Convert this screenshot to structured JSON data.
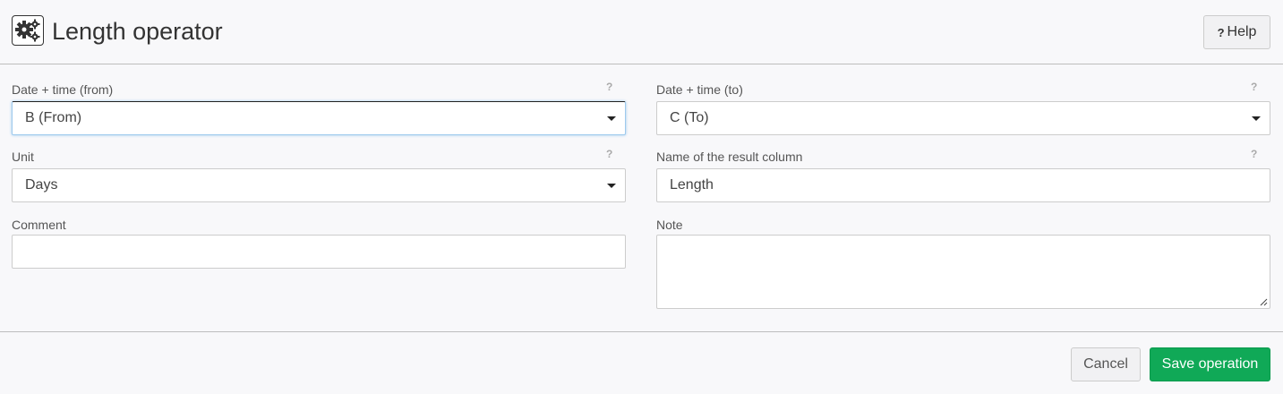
{
  "header": {
    "title": "Length operator",
    "icon": "gears-icon",
    "help_label": "Help"
  },
  "form": {
    "from": {
      "label": "Date + time (from)",
      "value": "B (From)",
      "hint": "?"
    },
    "to": {
      "label": "Date + time (to)",
      "value": "C (To)",
      "hint": "?"
    },
    "unit": {
      "label": "Unit",
      "value": "Days",
      "hint": "?"
    },
    "result_column": {
      "label": "Name of the result column",
      "value": "Length",
      "hint": "?"
    },
    "comment": {
      "label": "Comment",
      "value": ""
    },
    "note": {
      "label": "Note",
      "value": ""
    }
  },
  "footer": {
    "cancel_label": "Cancel",
    "save_label": "Save operation"
  },
  "colors": {
    "accent": "#10a957",
    "focus": "#9ecaed"
  }
}
